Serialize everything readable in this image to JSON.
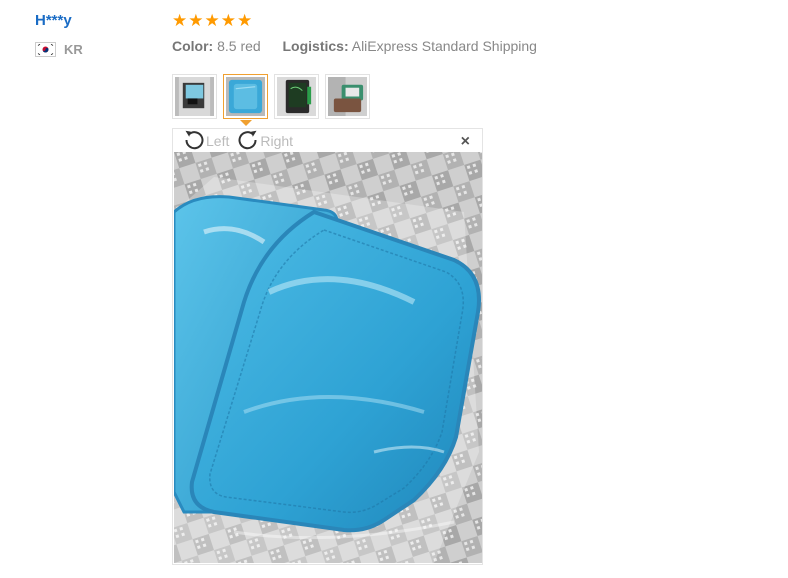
{
  "review": {
    "user_name": "H***y",
    "country_code": "KR",
    "rating_stars": 5,
    "color_label": "Color:",
    "color_value": "8.5 red",
    "logistics_label": "Logistics:",
    "logistics_value": "AliExpress Standard Shipping"
  },
  "gallery": {
    "thumbnails": [
      "photo-1",
      "photo-2",
      "photo-3",
      "photo-4"
    ],
    "active_index": 1
  },
  "viewer": {
    "rotate_left_label": "Left",
    "rotate_right_label": "Right",
    "close_glyph": "×"
  },
  "colors": {
    "user_link": "#1a6cc5",
    "star": "#ff9a00",
    "active_thumb_border": "#f0a030",
    "product_blue": "#3aa8d8"
  },
  "icons": [
    "flag-kr-icon",
    "star-icon",
    "rotate-left-icon",
    "rotate-right-icon",
    "close-icon"
  ]
}
